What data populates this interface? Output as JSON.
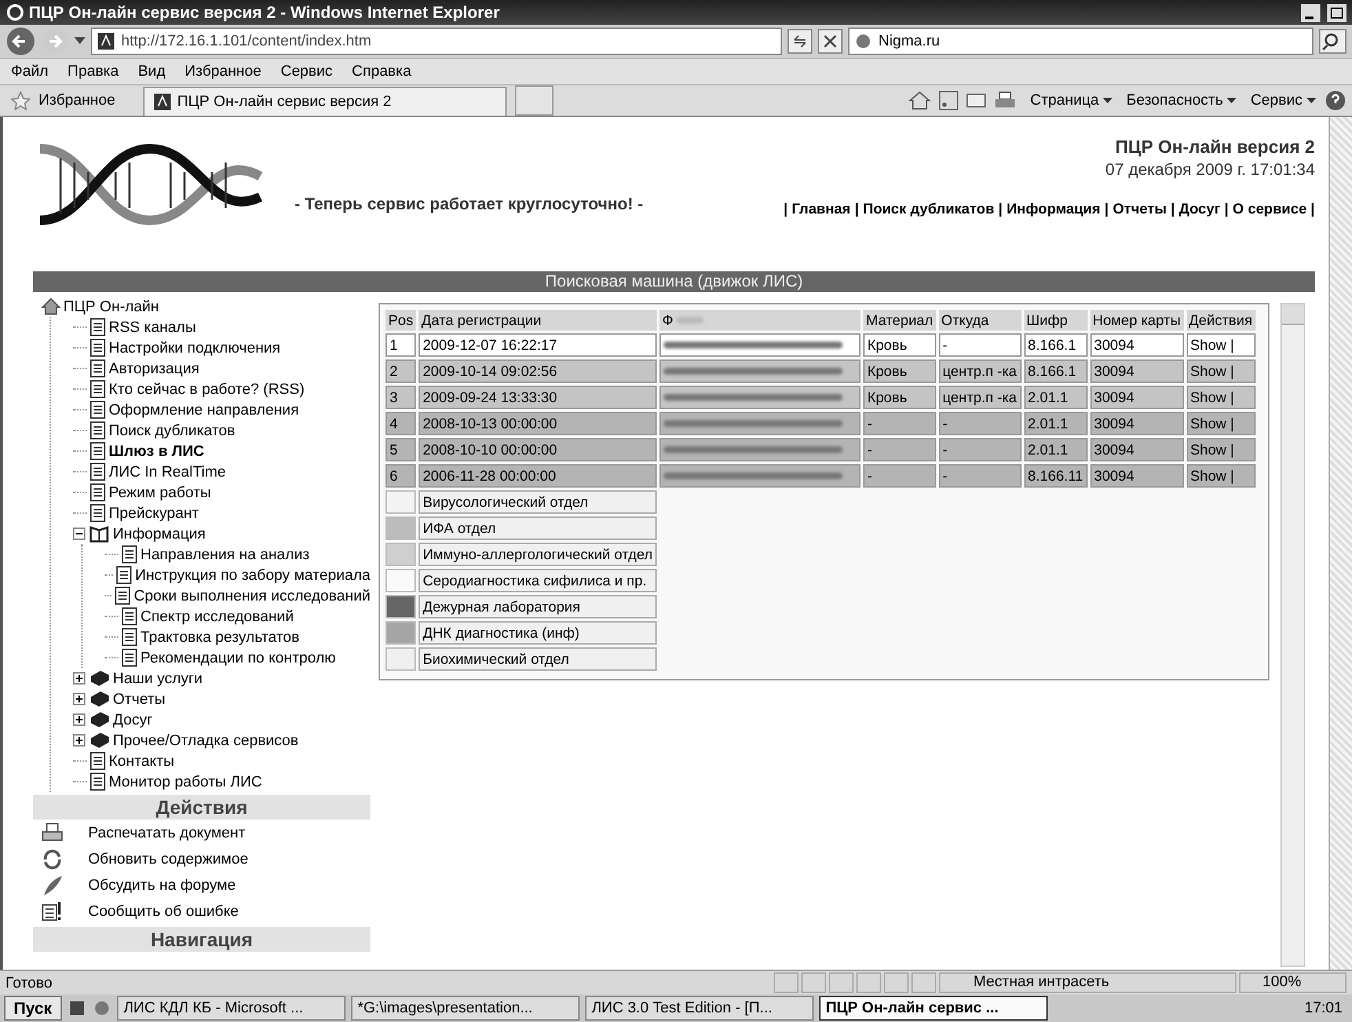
{
  "window": {
    "title": "ПЦР Он-лайн сервис версия 2 - Windows Internet Explorer"
  },
  "browser": {
    "address": "http://172.16.1.101/content/index.htm",
    "search": "Nigma.ru",
    "menu": [
      "Файл",
      "Правка",
      "Вид",
      "Избранное",
      "Сервис",
      "Справка"
    ],
    "favorites": "Избранное",
    "tab": "ПЦР Он-лайн сервис версия 2",
    "tools": [
      "Страница",
      "Безопасность",
      "Сервис"
    ]
  },
  "header": {
    "site_title": "ПЦР Он-лайн версия 2",
    "date": "07 декабря 2009 г. 17:01:34",
    "slogan": "- Теперь сервис работает круглосуточно! -",
    "separator": "|",
    "links": [
      "Главная",
      "Поиск дубликатов",
      "Информация",
      "Отчеты",
      "Досуг",
      "О сервисе"
    ]
  },
  "section_title": "Поисковая машина (движок ЛИС)",
  "tree": {
    "label": "ПЦР Он-лайн",
    "kind": "home",
    "children": [
      {
        "label": "RSS каналы",
        "kind": "page",
        "bold": false
      },
      {
        "label": "Настройки подключения",
        "kind": "page",
        "bold": false
      },
      {
        "label": "Авторизация",
        "kind": "page",
        "bold": false
      },
      {
        "label": "Кто сейчас в работе? (RSS)",
        "kind": "page",
        "bold": false
      },
      {
        "label": "Оформление направления",
        "kind": "page",
        "bold": false
      },
      {
        "label": "Поиск дубликатов",
        "kind": "page",
        "bold": false
      },
      {
        "label": "Шлюз в ЛИС",
        "kind": "page",
        "bold": true
      },
      {
        "label": "ЛИС In RealTime",
        "kind": "page",
        "bold": false
      },
      {
        "label": "Режим работы",
        "kind": "page",
        "bold": false
      },
      {
        "label": "Прейскурант",
        "kind": "page",
        "bold": false
      },
      {
        "label": "Информация",
        "kind": "openbook",
        "expanded": true,
        "bold": false,
        "children": [
          {
            "label": "Направления на анализ",
            "kind": "page",
            "bold": false
          },
          {
            "label": "Инструкция по забору материала",
            "kind": "page",
            "bold": false
          },
          {
            "label": "Сроки выполнения исследований",
            "kind": "page",
            "bold": false
          },
          {
            "label": "Спектр исследований",
            "kind": "page",
            "bold": false
          },
          {
            "label": "Трактовка результатов",
            "kind": "page",
            "bold": false
          },
          {
            "label": "Рекомендации по контролю",
            "kind": "page",
            "bold": false
          }
        ]
      },
      {
        "label": "Наши услуги",
        "kind": "book",
        "expanded": false,
        "bold": false
      },
      {
        "label": "Отчеты",
        "kind": "book",
        "expanded": false,
        "bold": false
      },
      {
        "label": "Досуг",
        "kind": "book",
        "expanded": false,
        "bold": false
      },
      {
        "label": "Прочее/Отладка сервисов",
        "kind": "book",
        "expanded": false,
        "bold": false
      },
      {
        "label": "Контакты",
        "kind": "page",
        "bold": false
      },
      {
        "label": "Монитор работы ЛИС",
        "kind": "page",
        "bold": false
      }
    ]
  },
  "actions": {
    "title": "Действия",
    "items": [
      {
        "label": "Распечатать документ",
        "kind": "print"
      },
      {
        "label": "Обновить содержимое",
        "kind": "refresh"
      },
      {
        "label": "Обсудить на форуме",
        "kind": "feather"
      },
      {
        "label": "Сообщить об ошибке",
        "kind": "report"
      }
    ]
  },
  "navigation": {
    "title": "Навигация"
  },
  "table": {
    "columns": [
      "Pos",
      "Дата регистрации",
      "Ф",
      "Материал",
      "Откуда",
      "Шифр",
      "Номер карты",
      "Действия"
    ],
    "rows": [
      {
        "color": "#ffffff",
        "cells": [
          "1",
          "2009-12-07 16:22:17",
          "",
          "Кровь",
          "-",
          "8.166.1",
          "30094",
          "Show |"
        ]
      },
      {
        "color": "#c4c4c4",
        "cells": [
          "2",
          "2009-10-14 09:02:56",
          "",
          "Кровь",
          "центр.п -ка",
          "8.166.1",
          "30094",
          "Show |"
        ]
      },
      {
        "color": "#c4c4c4",
        "cells": [
          "3",
          "2009-09-24 13:33:30",
          "",
          "Кровь",
          "центр.п -ка",
          "2.01.1",
          "30094",
          "Show |"
        ]
      },
      {
        "color": "#b4b4b4",
        "cells": [
          "4",
          "2008-10-13 00:00:00",
          "",
          "-",
          "-",
          "2.01.1",
          "30094",
          "Show |"
        ]
      },
      {
        "color": "#b4b4b4",
        "cells": [
          "5",
          "2008-10-10 00:00:00",
          "",
          "-",
          "-",
          "2.01.1",
          "30094",
          "Show |"
        ]
      },
      {
        "color": "#b4b4b4",
        "cells": [
          "6",
          "2006-11-28 00:00:00",
          "",
          "-",
          "-",
          "8.166.11",
          "30094",
          "Show |"
        ]
      }
    ]
  },
  "legend": [
    {
      "label": "Вирусологический отдел",
      "color": "#f4f4f4"
    },
    {
      "label": "ИФА отдел",
      "color": "#bcbcbc"
    },
    {
      "label": "Иммуно-аллергологический отдел",
      "color": "#cfcfcf"
    },
    {
      "label": "Серодиагностика сифилиса и пр.",
      "color": "#fafafa"
    },
    {
      "label": "Дежурная лаборатория",
      "color": "#666666"
    },
    {
      "label": "ДНК диагностика (инф)",
      "color": "#a6a6a6"
    },
    {
      "label": "Биохимический отдел",
      "color": "#f0f0f0"
    }
  ],
  "status": {
    "text": "Готово",
    "zone": "Местная интрасеть",
    "zoom": "100%"
  },
  "taskbar": {
    "start": "Пуск",
    "tasks": [
      {
        "label": "ЛИС КДЛ КБ - Microsoft ...",
        "selected": false
      },
      {
        "label": "*G:\\images\\presentation...",
        "selected": false
      },
      {
        "label": "ЛИС 3.0 Test Edition - [П...",
        "selected": false
      },
      {
        "label": "ПЦР Он-лайн сервис ...",
        "selected": true
      }
    ],
    "clock": "17:01"
  }
}
